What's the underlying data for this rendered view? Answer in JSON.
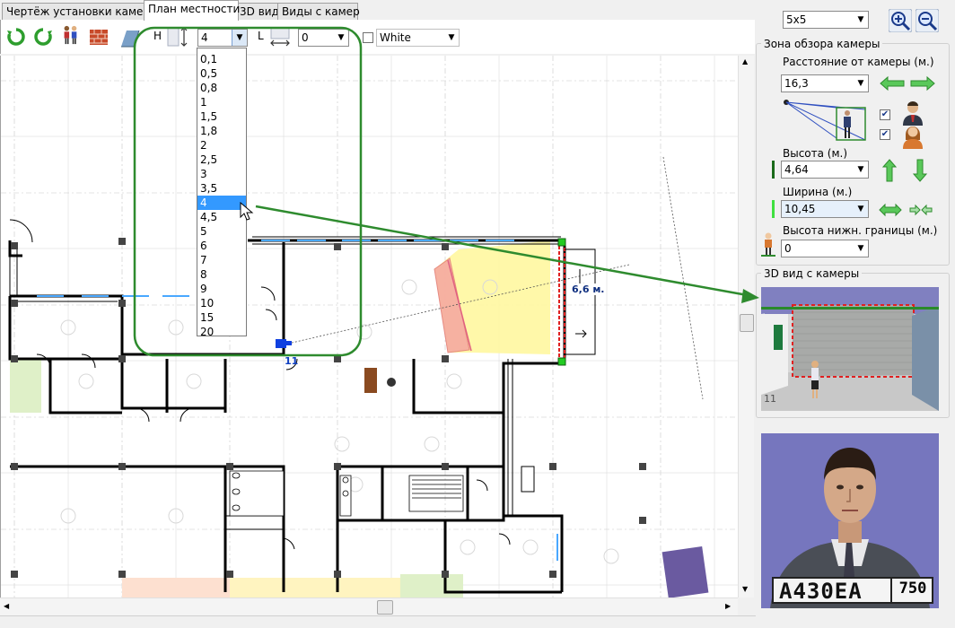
{
  "tabs": [
    {
      "label": "Чертёж установки камеры",
      "active": false
    },
    {
      "label": "План местности",
      "active": true
    },
    {
      "label": "3D вид",
      "active": false
    },
    {
      "label": "Виды с камер",
      "active": false
    }
  ],
  "toolbar": {
    "height_label": "H",
    "height_value": "4",
    "length_label": "L",
    "length_value": "0",
    "color_value": "White",
    "height_options": [
      "0,1",
      "0,5",
      "0,8",
      "1",
      "1,5",
      "1,8",
      "2",
      "2,5",
      "3",
      "3,5",
      "4",
      "4,5",
      "5",
      "6",
      "7",
      "8",
      "9",
      "10",
      "15",
      "20"
    ],
    "height_selected_index": 10
  },
  "map": {
    "camera_label": "11",
    "distance_annotation": "6,6 м."
  },
  "right_panel": {
    "grid_select": "5x5",
    "zone_group_title": "Зона обзора камеры",
    "distance_label": "Расстояние от камеры (м.)",
    "distance_value": "16,3",
    "height_label": "Высота (м.)",
    "height_value": "4,64",
    "width_label": "Ширина (м.)",
    "width_value": "10,45",
    "lower_bound_label": "Высота нижн. границы (м.)",
    "lower_bound_value": "0",
    "view3d_title": "3D вид с камеры",
    "view3d_camera_label": "11",
    "plate_text": "А430ЕА",
    "plate_region": "750"
  },
  "colors": {
    "accent_green": "#2e8b2e",
    "zone_yellow": "#fff7a0",
    "zone_pink": "#f4a0a0",
    "selection_blue": "#3399ff"
  }
}
